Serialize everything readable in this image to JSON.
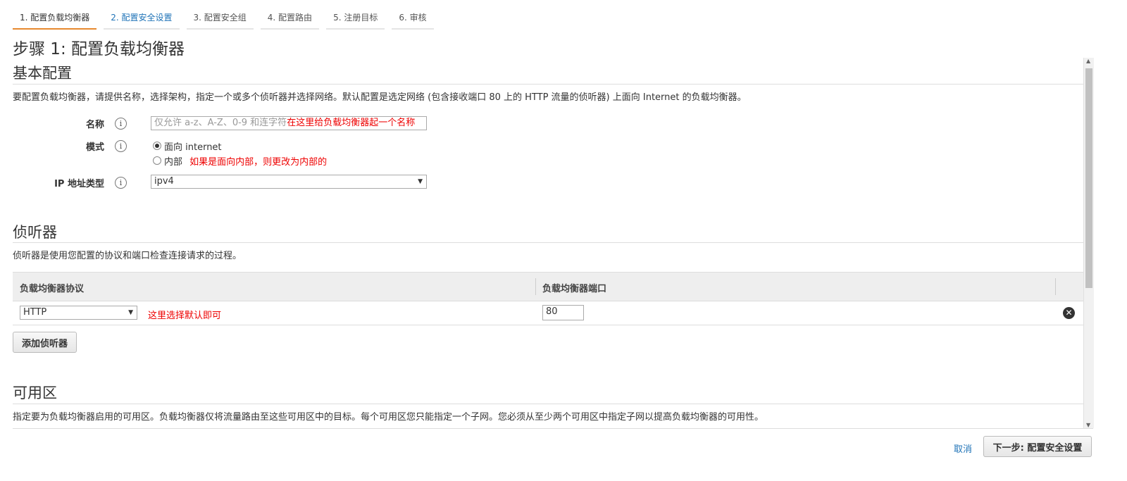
{
  "tabs": [
    {
      "label": "1. 配置负载均衡器"
    },
    {
      "label": "2. 配置安全设置"
    },
    {
      "label": "3. 配置安全组"
    },
    {
      "label": "4. 配置路由"
    },
    {
      "label": "5. 注册目标"
    },
    {
      "label": "6. 审核"
    }
  ],
  "page_title": "步骤 1: 配置负载均衡器",
  "basic": {
    "title": "基本配置",
    "description": "要配置负载均衡器，请提供名称，选择架构，指定一个或多个侦听器并选择网络。默认配置是选定网络 (包含接收端口 80 上的 HTTP 流量的侦听器) 上面向 Internet 的负载均衡器。",
    "name_label": "名称",
    "name_placeholder": "仅允许 a-z、A-Z、0-9 和连字符",
    "name_annotation": "在这里给负载均衡器起一个名称",
    "scheme_label": "模式",
    "scheme_option_internet": "面向 internet",
    "scheme_option_internal": "内部",
    "scheme_annotation": "如果是面向内部，则更改为内部的",
    "ip_label": "IP 地址类型",
    "ip_value": "ipv4"
  },
  "listeners": {
    "title": "侦听器",
    "description": "侦听器是使用您配置的协议和端口检查连接请求的过程。",
    "col_protocol": "负载均衡器协议",
    "col_port": "负载均衡器端口",
    "rows": [
      {
        "protocol": "HTTP",
        "annotation": "这里选择默认即可",
        "port": "80"
      }
    ],
    "add_button": "添加侦听器"
  },
  "az": {
    "title": "可用区",
    "description": "指定要为负载均衡器启用的可用区。负载均衡器仅将流量路由至这些可用区中的目标。每个可用区您只能指定一个子网。您必须从至少两个可用区中指定子网以提高负载均衡器的可用性。"
  },
  "footer": {
    "cancel": "取消",
    "next": "下一步: 配置安全设置"
  },
  "icons": {
    "info": "info-icon",
    "remove": "remove-circle-icon",
    "caret": "caret-down-icon"
  },
  "colors": {
    "active_tab_underline": "#e7892f",
    "link": "#1f73b7",
    "annotation_red": "#e00000"
  }
}
